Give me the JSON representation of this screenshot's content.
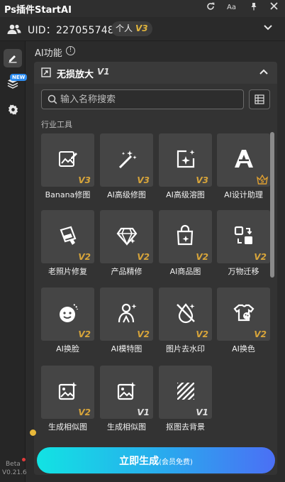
{
  "app": {
    "title": "Ps插件StartAI"
  },
  "titlebar": {
    "refresh_icon": "refresh-icon",
    "font_icon_label": "Aa",
    "pin_icon": "pin-icon",
    "close_icon": "close-icon"
  },
  "account": {
    "uid": "UID：2270557484",
    "plan": "个人",
    "plan_version": "V3"
  },
  "sidebar": {
    "items": [
      {
        "name": "edit",
        "icon": "edit-icon",
        "active": true
      },
      {
        "name": "layers",
        "icon": "layers-icon",
        "badge": "NEW"
      },
      {
        "name": "settings",
        "icon": "gear-icon"
      }
    ],
    "beta_label": "Beta",
    "version": "V0.21.6"
  },
  "section": {
    "title": "AI功能",
    "info_icon": "info-icon"
  },
  "panel": {
    "title": "无损放大",
    "version": "V1",
    "search_placeholder": "输入名称搜索",
    "category_label": "行业工具"
  },
  "tools": [
    {
      "label": "Banana修图",
      "tag": "V3",
      "icon": "image-edit-icon"
    },
    {
      "label": "AI高级修图",
      "tag": "V3",
      "icon": "magic-wand-icon"
    },
    {
      "label": "AI高级溶图",
      "tag": "V3",
      "icon": "sparkle-frame-icon"
    },
    {
      "label": "AI设计助理",
      "tag": "S",
      "icon": "ai-assistant-icon"
    },
    {
      "label": "老照片修复",
      "tag": "V2",
      "icon": "photo-repair-icon"
    },
    {
      "label": "产品精修",
      "tag": "V2",
      "icon": "gem-icon"
    },
    {
      "label": "AI商品图",
      "tag": "V2",
      "icon": "shopping-bag-icon"
    },
    {
      "label": "万物迁移",
      "tag": "V2",
      "icon": "transfer-icon"
    },
    {
      "label": "AI换脸",
      "tag": "V2",
      "icon": "face-swap-icon"
    },
    {
      "label": "AI模特图",
      "tag": "V2",
      "icon": "model-icon"
    },
    {
      "label": "图片去水印",
      "tag": "V2",
      "icon": "no-watermark-icon"
    },
    {
      "label": "AI换色",
      "tag": "V2",
      "icon": "recolor-icon"
    },
    {
      "label": "生成相似图",
      "tag": "V2",
      "icon": "similar-image-icon"
    },
    {
      "label": "生成相似图",
      "tag": "V1",
      "icon": "similar-image-icon"
    },
    {
      "label": "抠图去背景",
      "tag": "V1",
      "icon": "remove-bg-icon"
    }
  ],
  "generate": {
    "label": "立即生成",
    "sub_label": "(会员免费)"
  },
  "colors": {
    "accent_gold": "#d8a53a",
    "button_gradient_start": "#12e3e3",
    "button_gradient_end": "#4b6ff5"
  }
}
